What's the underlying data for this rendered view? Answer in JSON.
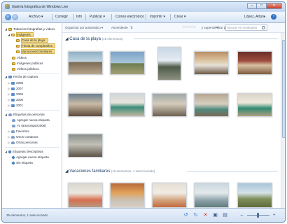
{
  "window": {
    "title": "Galería fotográfica de Windows Live"
  },
  "toolbar": {
    "menus": [
      "Archivo ▾",
      "Corregir",
      "Info",
      "Publicar ▾",
      "Correo electrónico",
      "Imprimir ▾",
      "Crear ▾"
    ],
    "user": "López, Arturo"
  },
  "sidebar": {
    "items": [
      "Todas las fotografías y vídeos",
      "Imágenes",
      "Casa de la playa",
      "Fiesta de cumpleaños",
      "Vacaciones familiares",
      "Vídeos",
      "Imágenes públicas",
      "Vídeos públicos",
      "Fecha de captura",
      "2008",
      "2007",
      "2006",
      "2005",
      "2001",
      "Etiquetas de personas",
      "Agregar nueva etiqueta",
      "Yo (arturolopez2008)",
      "Favoritos",
      "Otros contactos",
      "Otras personas",
      "Etiquetas descriptivas",
      "Agregar nueva etiqueta",
      "Sin etiqueta"
    ]
  },
  "filterbar": {
    "sort": "Organizar por automático ▾",
    "order": "Ascendente",
    "filter": "Filtrar por",
    "superior": "y superior ▾",
    "search_placeholder": "Buscar en resultados"
  },
  "groups": [
    {
      "name": "Casa de la playa",
      "count": "(15 elementos)"
    },
    {
      "name": "Vacaciones familiares",
      "count": "(19 elementos, 1 seleccionado)"
    }
  ],
  "statusbar": {
    "text": "35 elementos, 1 seleccionado"
  },
  "colors": {
    "selection": "#f6dc86",
    "accent": "#1f3d66"
  }
}
